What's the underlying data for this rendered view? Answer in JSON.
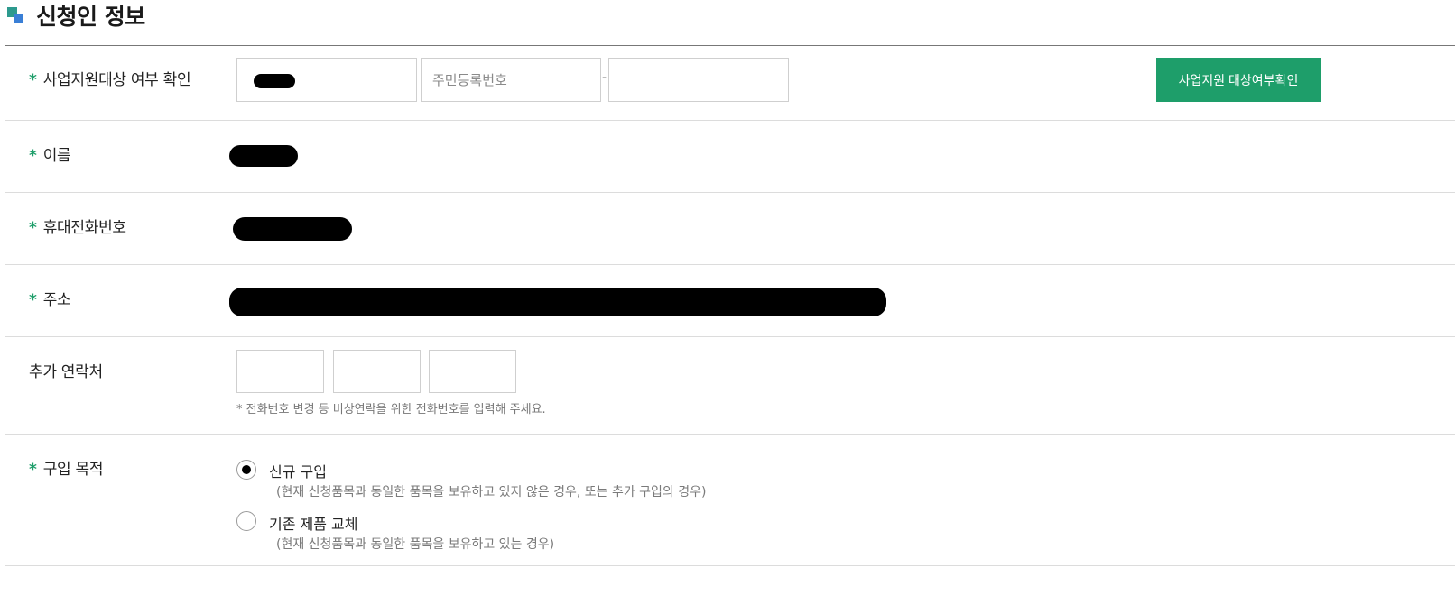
{
  "section": {
    "title": "신청인 정보"
  },
  "colors": {
    "accent": "#1e9e6a",
    "required": "#1e9e6a"
  },
  "rows": {
    "eligibility": {
      "label": "사업지원대상 여부 확인",
      "resident_placeholder": "주민등록번호",
      "dash": "-",
      "button_label": "사업지원 대상여부확인"
    },
    "name": {
      "label": "이름"
    },
    "mobile": {
      "label": "휴대전화번호"
    },
    "address": {
      "label": "주소"
    },
    "extra_contact": {
      "label": "추가 연락처",
      "hint": "*  전화번호 변경 등 비상연락을 위한 전화번호를 입력해 주세요."
    },
    "purpose": {
      "label": "구입 목적",
      "options": [
        {
          "label": "신규 구입",
          "desc": "(현재 신청품목과 동일한 품목을 보유하고 있지 않은 경우, 또는 추가 구입의 경우)",
          "selected": true
        },
        {
          "label": "기존 제품 교체",
          "desc": "(현재 신청품목과 동일한 품목을 보유하고 있는 경우)",
          "selected": false
        }
      ]
    }
  },
  "required_mark": "*"
}
